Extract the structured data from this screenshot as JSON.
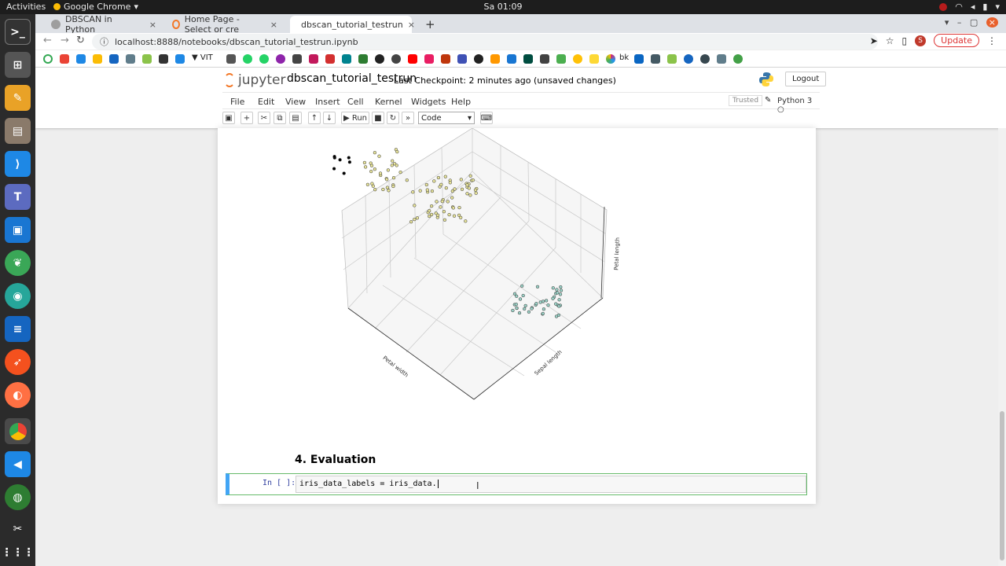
{
  "topbar": {
    "activities": "Activities",
    "app": "Google Chrome",
    "clock": "Sa 01:09"
  },
  "browser": {
    "tabs": [
      {
        "title": "DBSCAN in Python",
        "close": "×"
      },
      {
        "title": "Home Page - Select or cre",
        "close": "×"
      },
      {
        "title": "dbscan_tutorial_testrun",
        "close": "×"
      }
    ],
    "new_tab": "+",
    "url": "localhost:8888/notebooks/dbscan_tutorial_testrun.ipynb",
    "avatar_letter": "S",
    "update_label": "Update",
    "bookmark_vit": "VIT",
    "bookmark_bk": "bk"
  },
  "jupyter": {
    "logo_text": "jupyter",
    "notebook_name": "dbscan_tutorial_testrun",
    "checkpoint": "Last Checkpoint: 2 minutes ago  (unsaved changes)",
    "logout": "Logout",
    "menus": [
      "File",
      "Edit",
      "View",
      "Insert",
      "Cell",
      "Kernel",
      "Widgets",
      "Help"
    ],
    "trusted": "Trusted",
    "kernel_name": "Python 3",
    "run_label": "Run",
    "cell_type": "Code"
  },
  "plot": {
    "axis_labels": {
      "x": "Petal width",
      "y": "Sepal length",
      "z": "Petal length"
    },
    "colors": {
      "cluster_a": "#e8e49a",
      "cluster_b": "#9ad1c6",
      "noise": "#000000"
    }
  },
  "notebook": {
    "heading": "4. Evaluation",
    "prompt": "In [ ]:",
    "code": "iris_data_labels = iris_data."
  }
}
